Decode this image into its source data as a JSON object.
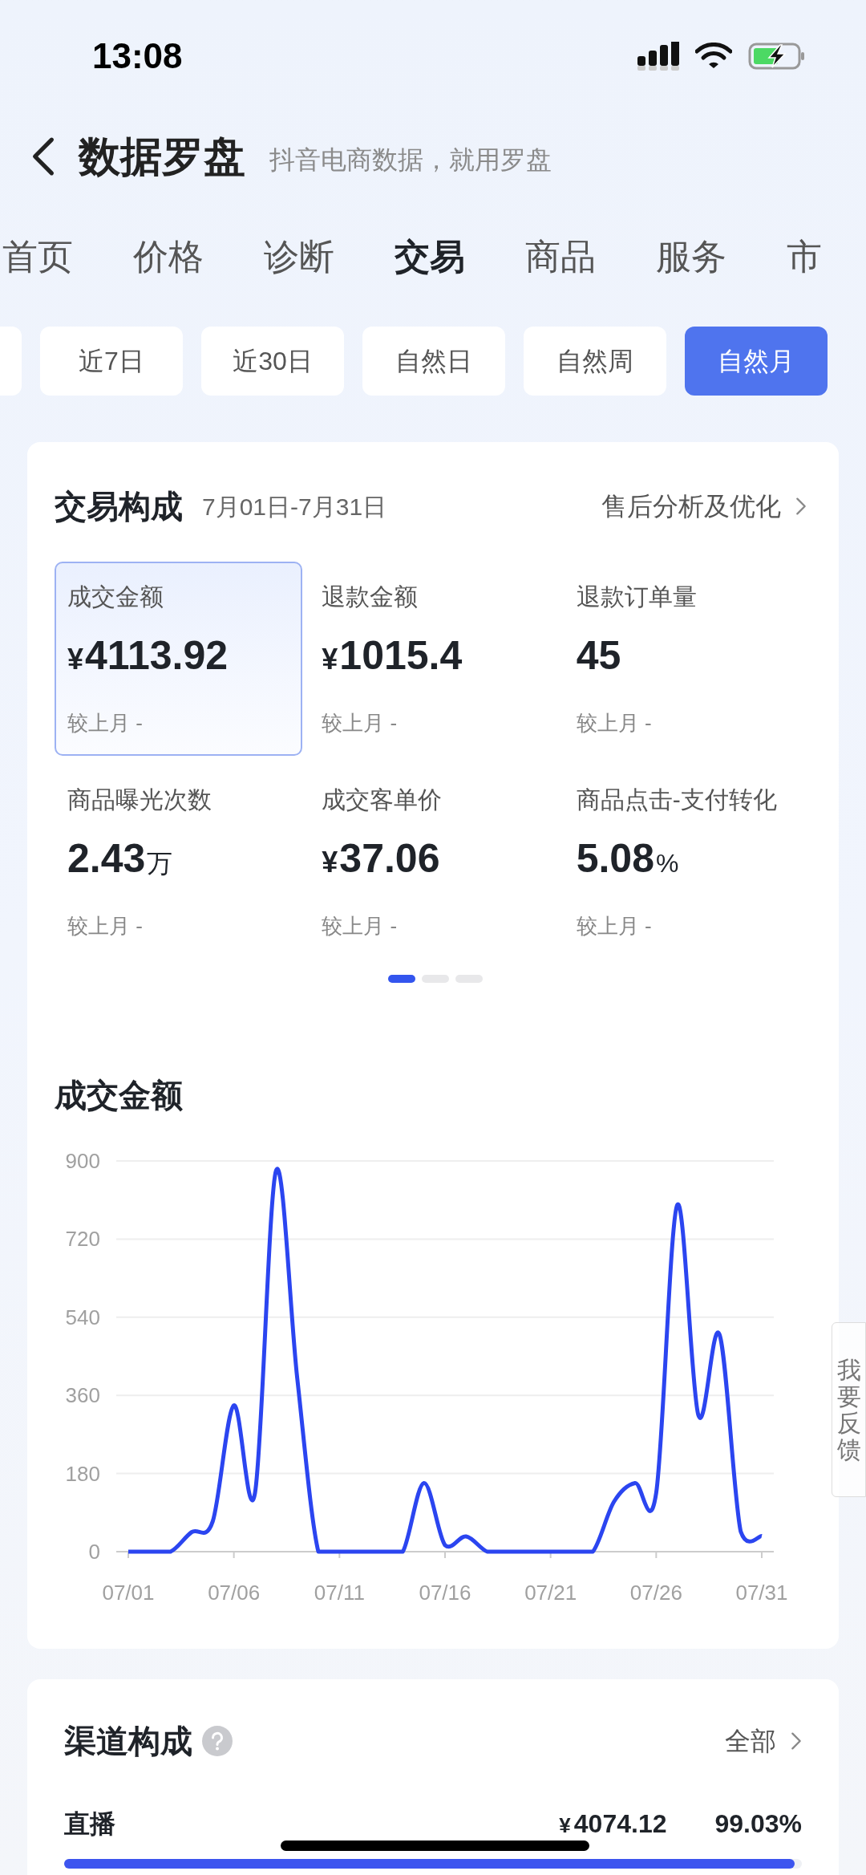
{
  "status_bar": {
    "time": "13:08"
  },
  "header": {
    "title": "数据罗盘",
    "subtitle": "抖音电商数据，就用罗盘"
  },
  "tabs": [
    {
      "label": "首页",
      "selected": false
    },
    {
      "label": "价格",
      "selected": false
    },
    {
      "label": "诊断",
      "selected": false
    },
    {
      "label": "交易",
      "selected": true
    },
    {
      "label": "商品",
      "selected": false
    },
    {
      "label": "服务",
      "selected": false
    },
    {
      "label": "市",
      "selected": false
    }
  ],
  "date_filters": [
    {
      "label": "近7日",
      "selected": false
    },
    {
      "label": "近30日",
      "selected": false
    },
    {
      "label": "自然日",
      "selected": false
    },
    {
      "label": "自然周",
      "selected": false
    },
    {
      "label": "自然月",
      "selected": true
    }
  ],
  "trade_card": {
    "title": "交易构成",
    "date_range": "7月01日-7月31日",
    "link": "售后分析及优化",
    "metrics": [
      {
        "label": "成交金额",
        "prefix": "¥",
        "value": "4113.92",
        "compare": "较上月 -",
        "selected": true
      },
      {
        "label": "退款金额",
        "prefix": "¥",
        "value": "1015.4",
        "compare": "较上月 -",
        "selected": false
      },
      {
        "label": "退款订单量",
        "value": "45",
        "compare": "较上月 -",
        "selected": false
      },
      {
        "label": "商品曝光次数",
        "value": "2.43",
        "suffix": "万",
        "compare": "较上月 -",
        "selected": false
      },
      {
        "label": "成交客单价",
        "prefix": "¥",
        "value": "37.06",
        "compare": "较上月 -",
        "selected": false
      },
      {
        "label": "商品点击-支付转化",
        "value": "5.08",
        "suffix": "%",
        "compare": "较上月 -",
        "selected": false
      }
    ],
    "pages": [
      {
        "selected": true
      },
      {
        "selected": false
      },
      {
        "selected": false
      }
    ],
    "chart": {
      "title": "成交金额",
      "chart_data": {
        "type": "line",
        "categories": [
          "07/01",
          null,
          null,
          null,
          null,
          "07/06",
          null,
          null,
          null,
          null,
          "07/11",
          null,
          null,
          null,
          null,
          "07/16",
          null,
          null,
          null,
          null,
          "07/21",
          null,
          null,
          null,
          null,
          "07/26",
          null,
          null,
          null,
          null,
          "07/31"
        ],
        "series": [
          {
            "color": "#2b45f0",
            "values": [
              0,
              0,
              0,
              45,
              70,
              337,
              135,
              878,
              400,
              0,
              0,
              0,
              0,
              0,
              158,
              15,
              35,
              0,
              0,
              0,
              0,
              0,
              0,
              115,
              158,
              135,
              799,
              314,
              500,
              47,
              36
            ]
          }
        ],
        "ylim": [
          0,
          900
        ],
        "grid": true,
        "yticks": [
          0,
          180,
          360,
          540,
          720,
          900
        ]
      }
    }
  },
  "feedback": {
    "label": "我要反馈"
  },
  "channel_card": {
    "title": "渠道构成",
    "link": "全部",
    "rows": [
      {
        "name": "直播",
        "prefix": "¥",
        "amount": "4074.12",
        "share": "99.03%",
        "level": 0.99
      }
    ]
  }
}
